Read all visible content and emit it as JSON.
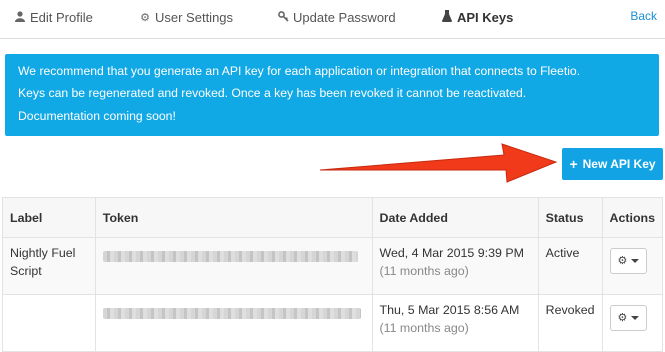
{
  "tabs": [
    {
      "label": "Edit Profile",
      "icon": "person-icon"
    },
    {
      "label": "User Settings",
      "icon": "gear-icon"
    },
    {
      "label": "Update Password",
      "icon": "key-icon"
    },
    {
      "label": "API Keys",
      "icon": "flask-icon",
      "active": true
    }
  ],
  "back_label": "Back",
  "alert": {
    "line1": "We recommend that you generate an API key for each application or integration that connects to Fleetio.",
    "line2": "Keys can be regenerated and revoked. Once a key has been revoked it cannot be reactivated.",
    "line3": "Documentation coming soon!"
  },
  "new_key_button": {
    "label": "New API Key",
    "icon": "plus-icon"
  },
  "table": {
    "headers": {
      "label": "Label",
      "token": "Token",
      "date": "Date Added",
      "status": "Status",
      "actions": "Actions"
    },
    "rows": [
      {
        "label": "Nightly Fuel Script",
        "date": "Wed, 4 Mar 2015 9:39 PM",
        "ago": "(11 months ago)",
        "status": "Active"
      },
      {
        "label": "",
        "date": "Thu, 5 Mar 2015 8:56 AM",
        "ago": "(11 months ago)",
        "status": "Revoked"
      }
    ]
  },
  "colors": {
    "alert_bg": "#11a8e6",
    "button_bg": "#12a3e4",
    "arrow": "#f03a1a",
    "link": "#1a8fd8"
  }
}
